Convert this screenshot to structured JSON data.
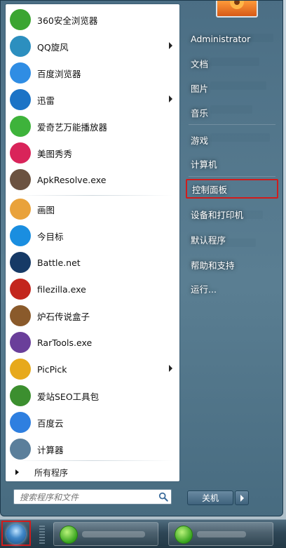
{
  "user": {
    "name": "Administrator"
  },
  "programs": [
    {
      "label": "360安全浏览器",
      "icon": "360-browser-icon",
      "color": "#3ba531",
      "arrow": false
    },
    {
      "label": "QQ旋风",
      "icon": "qq-xuanfeng-icon",
      "color": "#2c8fbf",
      "arrow": true
    },
    {
      "label": "百度浏览器",
      "icon": "baidu-browser-icon",
      "color": "#2f8de4",
      "arrow": false
    },
    {
      "label": "迅雷",
      "icon": "xunlei-icon",
      "color": "#1b73c6",
      "arrow": true
    },
    {
      "label": "爱奇艺万能播放器",
      "icon": "iqiyi-player-icon",
      "color": "#3eb33b",
      "arrow": false
    },
    {
      "label": "美图秀秀",
      "icon": "meitu-icon",
      "color": "#d9245a",
      "arrow": false
    },
    {
      "label": "ApkResolve.exe",
      "icon": "apkresolve-icon",
      "color": "#6b5240",
      "arrow": false
    },
    {
      "label": "画图",
      "icon": "paint-icon",
      "color": "#e9a23b",
      "arrow": false
    },
    {
      "label": "今目标",
      "icon": "jinmubiao-icon",
      "color": "#1a8ee0",
      "arrow": false
    },
    {
      "label": "Battle.net",
      "icon": "battlenet-icon",
      "color": "#163a66",
      "arrow": false
    },
    {
      "label": "filezilla.exe",
      "icon": "filezilla-icon",
      "color": "#c3261d",
      "arrow": false
    },
    {
      "label": "炉石传说盒子",
      "icon": "hearthstone-box-icon",
      "color": "#8a5a2b",
      "arrow": false
    },
    {
      "label": "RarTools.exe",
      "icon": "rartools-icon",
      "color": "#6a3f9a",
      "arrow": false
    },
    {
      "label": "PicPick",
      "icon": "picpick-icon",
      "color": "#e7a91c",
      "arrow": true
    },
    {
      "label": "爱站SEO工具包",
      "icon": "aizhan-seo-icon",
      "color": "#3c8f2f",
      "arrow": false
    },
    {
      "label": "百度云",
      "icon": "baidu-cloud-icon",
      "color": "#2e7fe0",
      "arrow": false
    },
    {
      "label": "计算器",
      "icon": "calculator-icon",
      "color": "#5b7f9b",
      "arrow": false
    }
  ],
  "all_programs": "所有程序",
  "search": {
    "placeholder": "搜索程序和文件"
  },
  "right_items": [
    {
      "label": "文档"
    },
    {
      "label": "图片"
    },
    {
      "label": "音乐"
    },
    {
      "label": "游戏"
    },
    {
      "label": "计算机"
    },
    {
      "label": "控制面板",
      "highlighted": true
    },
    {
      "label": "设备和打印机"
    },
    {
      "label": "默认程序"
    },
    {
      "label": "帮助和支持"
    },
    {
      "label": "运行..."
    }
  ],
  "shutdown": {
    "label": "关机"
  },
  "colors": {
    "highlight_border": "#d01c1c",
    "menu_bg": "#3a6078"
  }
}
